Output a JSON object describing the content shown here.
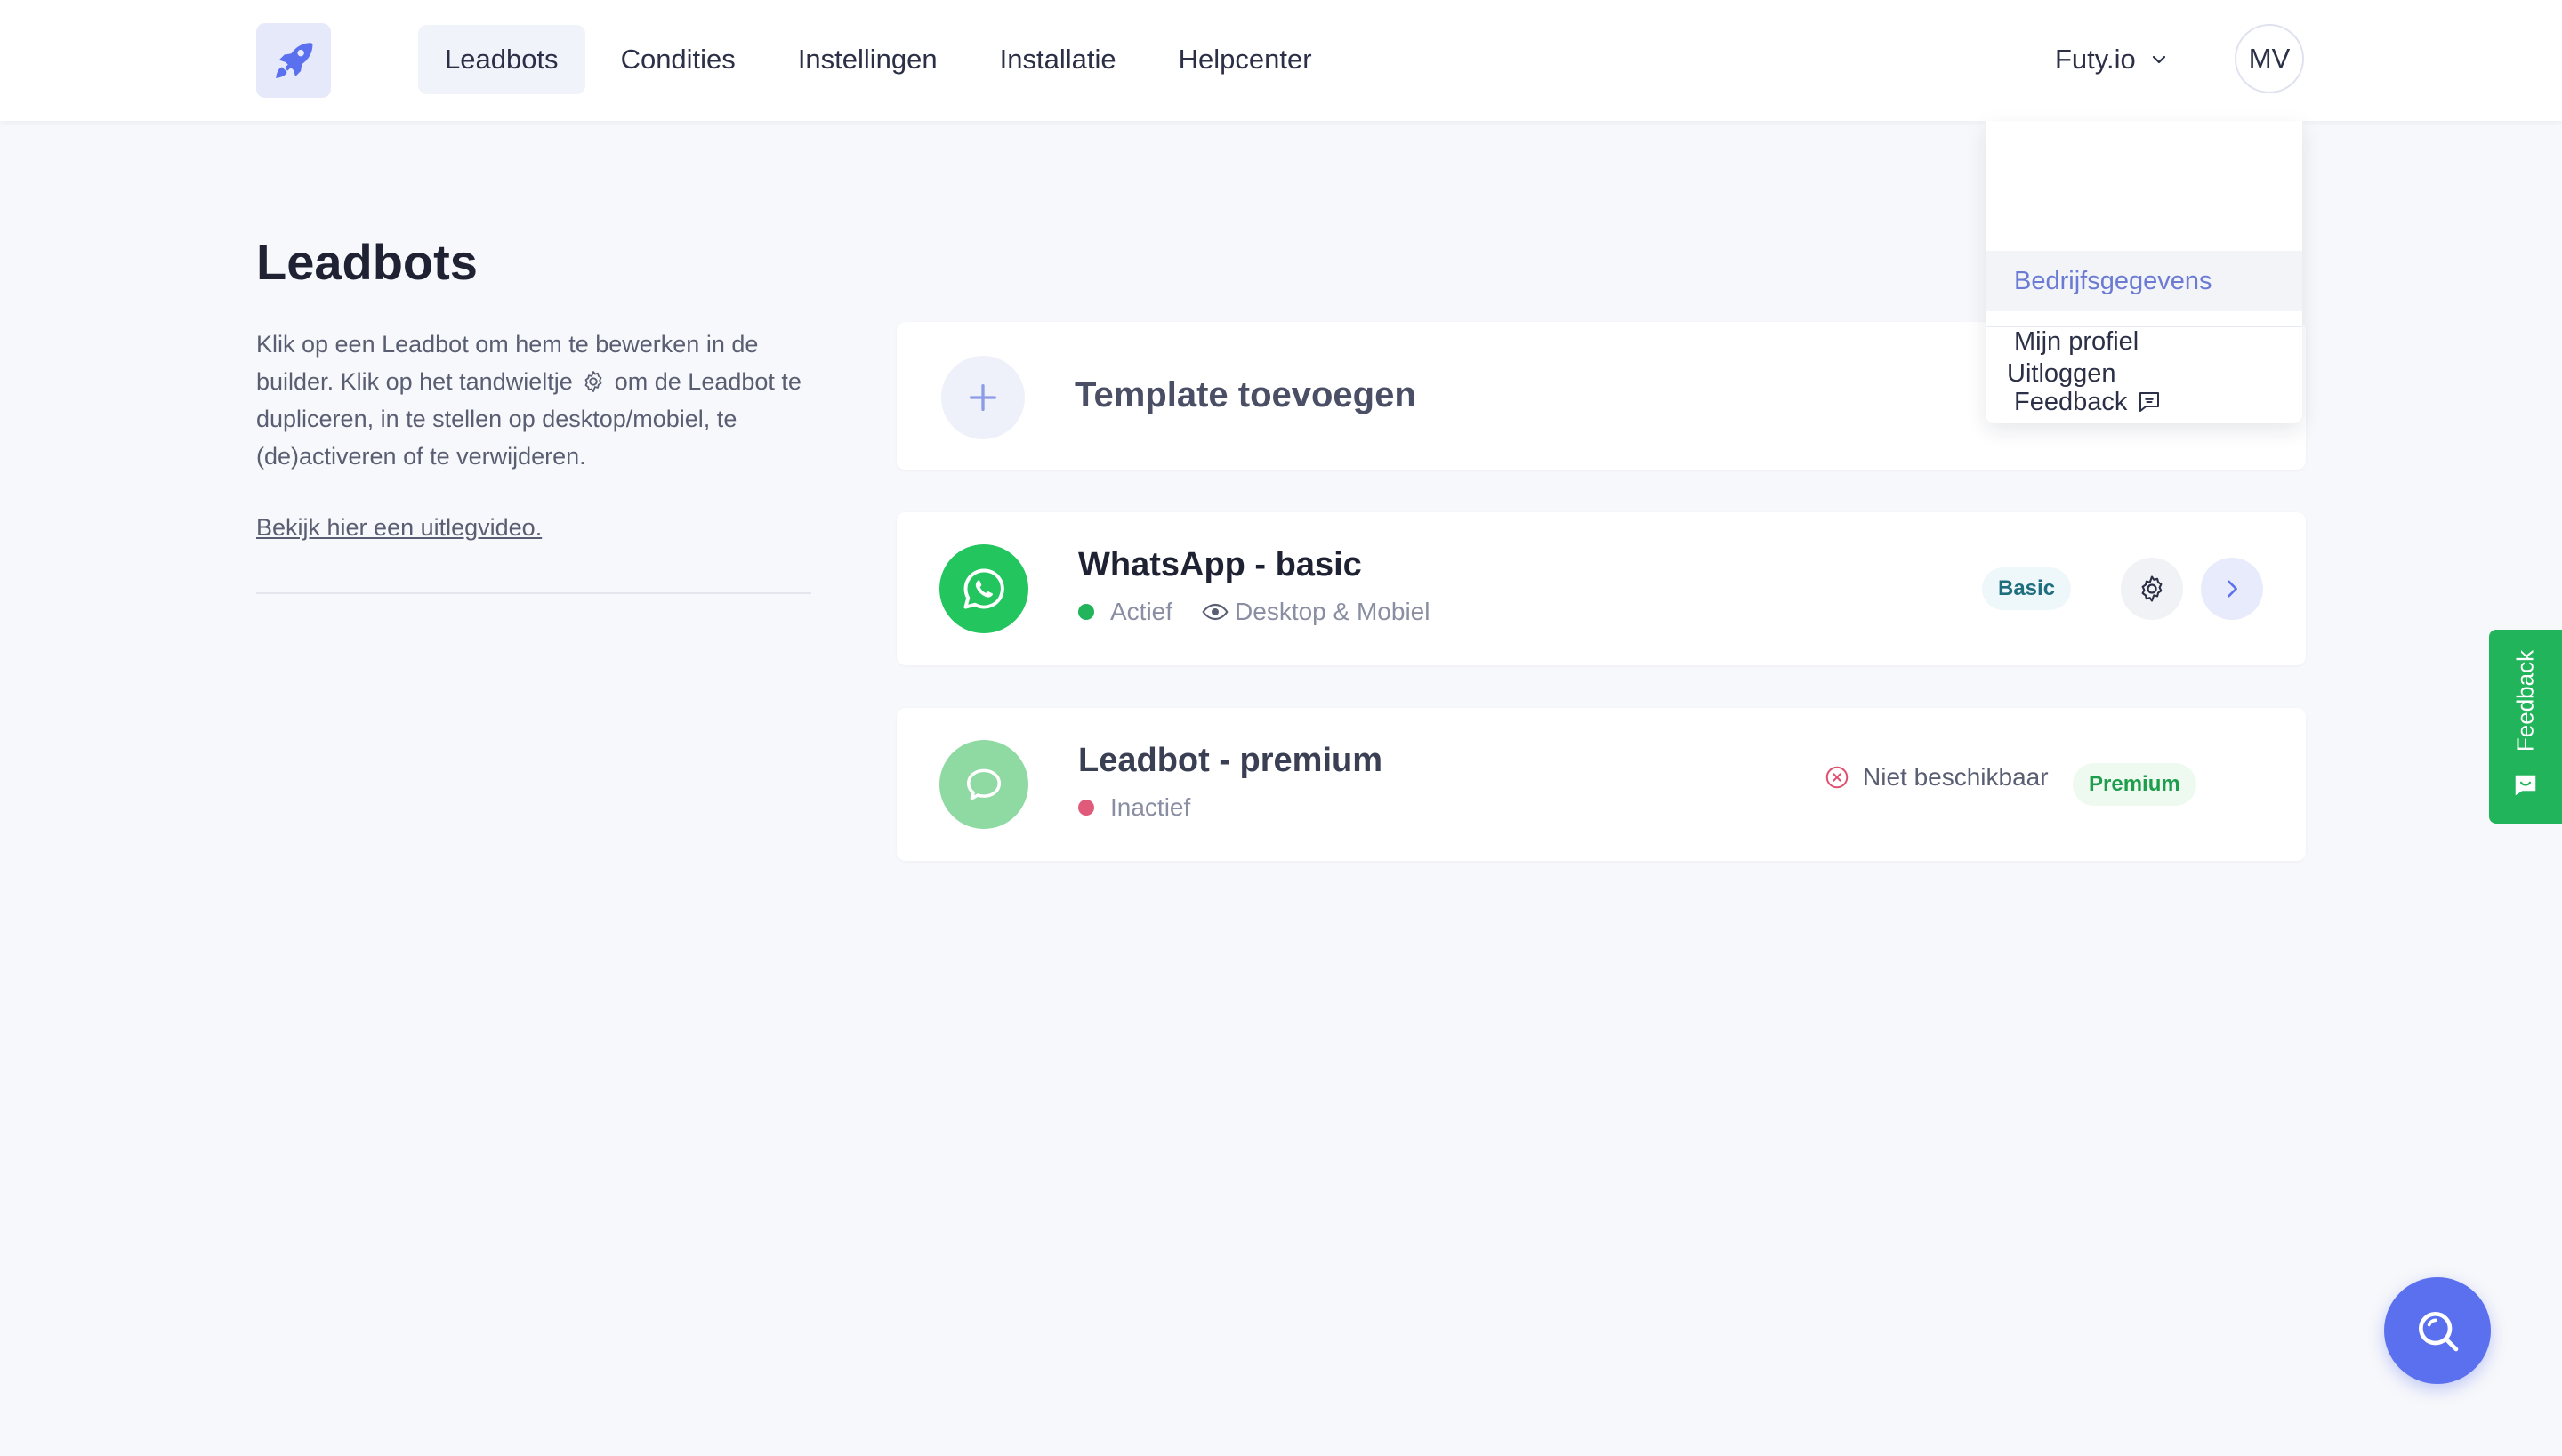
{
  "header": {
    "nav": [
      {
        "label": "Leadbots",
        "active": true
      },
      {
        "label": "Condities"
      },
      {
        "label": "Instellingen"
      },
      {
        "label": "Installatie"
      },
      {
        "label": "Helpcenter"
      }
    ],
    "account_name": "Futy.io",
    "avatar_initials": "MV"
  },
  "dropdown": {
    "items": [
      "Bedrijfsgegevens",
      "Mijn profiel",
      "Feedback"
    ],
    "logout": "Uitloggen"
  },
  "page": {
    "title": "Leadbots",
    "intro_part1": "Klik op een Leadbot om hem te bewerken in de builder. Klik op het tandwieltje",
    "intro_part2": "om de Leadbot te dupliceren, in te stellen op desktop/mobiel, te (de)activeren of te verwijderen.",
    "video_link": "Bekijk hier een uitlegvideo."
  },
  "add_template": {
    "label": "Template toevoegen"
  },
  "bots": [
    {
      "name": "WhatsApp - basic",
      "status": "Actief",
      "status_color": "#22b45a",
      "visibility": "Desktop & Mobiel",
      "badge": "Basic",
      "icon": "whatsapp-icon"
    },
    {
      "name": "Leadbot - premium",
      "status": "Inactief",
      "status_color": "#e05a7a",
      "availability": "Niet beschikbaar",
      "badge": "Premium",
      "icon": "chat-bubble-icon"
    }
  ],
  "feedback_tab": {
    "label": "Feedback"
  },
  "colors": {
    "accent": "#5b70ee",
    "green": "#22b45a",
    "highlight": "#6b7bd4"
  }
}
